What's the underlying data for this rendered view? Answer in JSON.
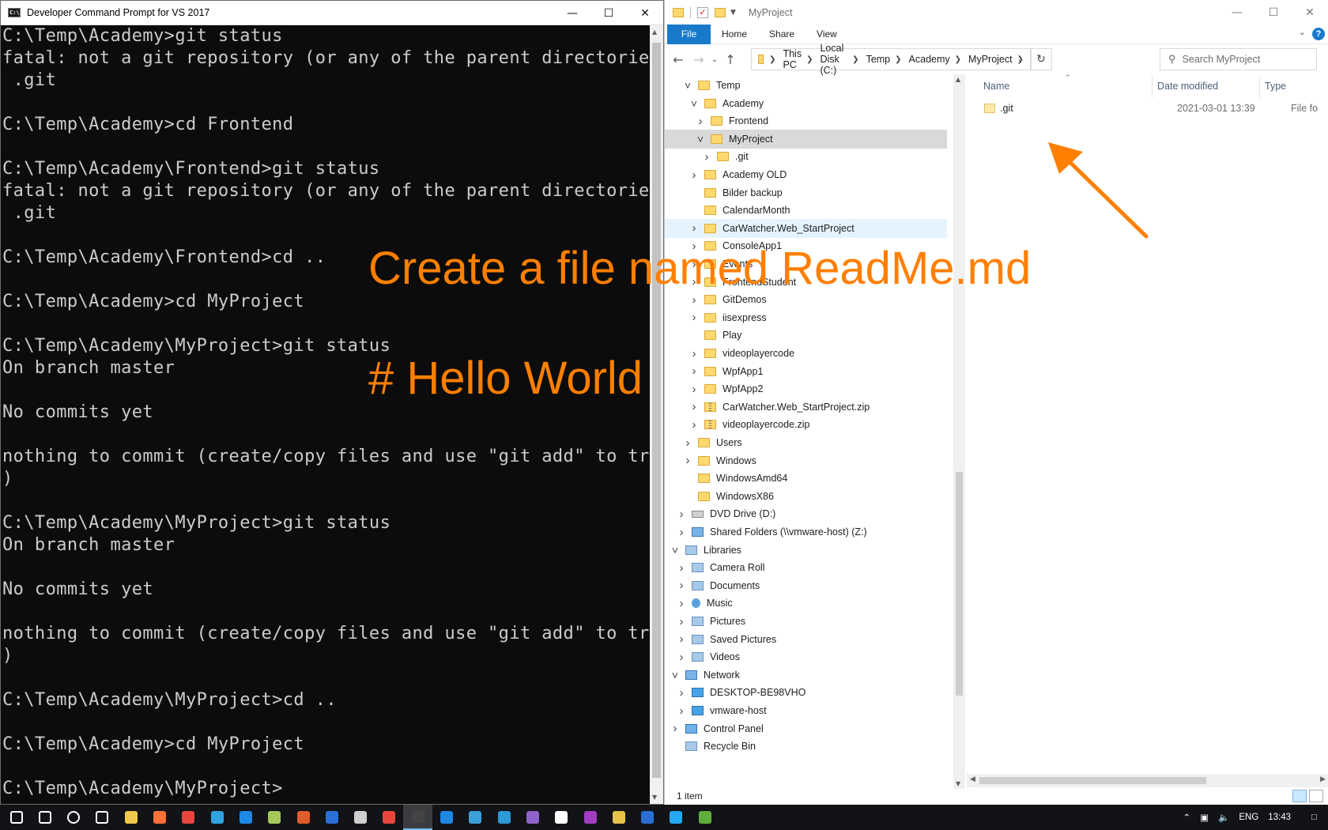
{
  "cmd": {
    "title": "Developer Command Prompt for VS 2017",
    "lines": [
      "C:\\Temp\\Academy>git status",
      "fatal: not a git repository (or any of the parent directories):",
      " .git",
      "",
      "C:\\Temp\\Academy>cd Frontend",
      "",
      "C:\\Temp\\Academy\\Frontend>git status",
      "fatal: not a git repository (or any of the parent directories):",
      " .git",
      "",
      "C:\\Temp\\Academy\\Frontend>cd ..",
      "",
      "C:\\Temp\\Academy>cd MyProject",
      "",
      "C:\\Temp\\Academy\\MyProject>git status",
      "On branch master",
      "",
      "No commits yet",
      "",
      "nothing to commit (create/copy files and use \"git add\" to track",
      ")",
      "",
      "C:\\Temp\\Academy\\MyProject>git status",
      "On branch master",
      "",
      "No commits yet",
      "",
      "nothing to commit (create/copy files and use \"git add\" to track",
      ")",
      "",
      "C:\\Temp\\Academy\\MyProject>cd ..",
      "",
      "C:\\Temp\\Academy>cd MyProject",
      "",
      "C:\\Temp\\Academy\\MyProject>"
    ]
  },
  "explorer": {
    "title": "MyProject",
    "ribbon_tabs": [
      "File",
      "Home",
      "Share",
      "View"
    ],
    "help": "?",
    "breadcrumbs": [
      "This PC",
      "Local Disk (C:)",
      "Temp",
      "Academy",
      "MyProject"
    ],
    "search_placeholder": "Search MyProject",
    "tree": [
      {
        "label": "Temp",
        "indent": 2,
        "arrow": "open",
        "icon": "folder"
      },
      {
        "label": "Academy",
        "indent": 3,
        "arrow": "open",
        "icon": "folder"
      },
      {
        "label": "Frontend",
        "indent": 4,
        "arrow": "closed",
        "icon": "folder"
      },
      {
        "label": "MyProject",
        "indent": 4,
        "arrow": "open",
        "icon": "folder",
        "selected": true
      },
      {
        "label": ".git",
        "indent": 5,
        "arrow": "closed",
        "icon": "folder"
      },
      {
        "label": "Academy OLD",
        "indent": 3,
        "arrow": "closed",
        "icon": "folder"
      },
      {
        "label": "Bilder backup",
        "indent": 3,
        "arrow": "none",
        "icon": "folder"
      },
      {
        "label": "CalendarMonth",
        "indent": 3,
        "arrow": "none",
        "icon": "folder"
      },
      {
        "label": "CarWatcher.Web_StartProject",
        "indent": 3,
        "arrow": "closed",
        "icon": "folder",
        "hover": true
      },
      {
        "label": "ConsoleApp1",
        "indent": 3,
        "arrow": "closed",
        "icon": "folder"
      },
      {
        "label": "Events",
        "indent": 3,
        "arrow": "closed",
        "icon": "folder"
      },
      {
        "label": "FrontendStudent",
        "indent": 3,
        "arrow": "closed",
        "icon": "folder"
      },
      {
        "label": "GitDemos",
        "indent": 3,
        "arrow": "closed",
        "icon": "folder"
      },
      {
        "label": "iisexpress",
        "indent": 3,
        "arrow": "closed",
        "icon": "folder"
      },
      {
        "label": "Play",
        "indent": 3,
        "arrow": "none",
        "icon": "folder"
      },
      {
        "label": "videoplayercode",
        "indent": 3,
        "arrow": "closed",
        "icon": "folder"
      },
      {
        "label": "WpfApp1",
        "indent": 3,
        "arrow": "closed",
        "icon": "folder"
      },
      {
        "label": "WpfApp2",
        "indent": 3,
        "arrow": "closed",
        "icon": "folder"
      },
      {
        "label": "CarWatcher.Web_StartProject.zip",
        "indent": 3,
        "arrow": "closed",
        "icon": "zip"
      },
      {
        "label": "videoplayercode.zip",
        "indent": 3,
        "arrow": "closed",
        "icon": "zip"
      },
      {
        "label": "Users",
        "indent": 2,
        "arrow": "closed",
        "icon": "folder"
      },
      {
        "label": "Windows",
        "indent": 2,
        "arrow": "closed",
        "icon": "folder"
      },
      {
        "label": "WindowsAmd64",
        "indent": 2,
        "arrow": "none",
        "icon": "folder"
      },
      {
        "label": "WindowsX86",
        "indent": 2,
        "arrow": "none",
        "icon": "folder"
      },
      {
        "label": "DVD Drive (D:)",
        "indent": 1,
        "arrow": "closed",
        "icon": "drive"
      },
      {
        "label": "Shared Folders (\\\\vmware-host) (Z:)",
        "indent": 1,
        "arrow": "closed",
        "icon": "net"
      },
      {
        "label": "Libraries",
        "indent": 0,
        "arrow": "open",
        "icon": "lib"
      },
      {
        "label": "Camera Roll",
        "indent": 1,
        "arrow": "closed",
        "icon": "lib"
      },
      {
        "label": "Documents",
        "indent": 1,
        "arrow": "closed",
        "icon": "lib"
      },
      {
        "label": "Music",
        "indent": 1,
        "arrow": "closed",
        "icon": "music"
      },
      {
        "label": "Pictures",
        "indent": 1,
        "arrow": "closed",
        "icon": "lib"
      },
      {
        "label": "Saved Pictures",
        "indent": 1,
        "arrow": "closed",
        "icon": "lib"
      },
      {
        "label": "Videos",
        "indent": 1,
        "arrow": "closed",
        "icon": "lib"
      },
      {
        "label": "Network",
        "indent": 0,
        "arrow": "open",
        "icon": "net"
      },
      {
        "label": "DESKTOP-BE98VHO",
        "indent": 1,
        "arrow": "closed",
        "icon": "pc"
      },
      {
        "label": "vmware-host",
        "indent": 1,
        "arrow": "closed",
        "icon": "pc"
      },
      {
        "label": "Control Panel",
        "indent": 0,
        "arrow": "closed",
        "icon": "cp"
      },
      {
        "label": "Recycle Bin",
        "indent": 0,
        "arrow": "none",
        "icon": "lib"
      }
    ],
    "columns": {
      "name": "Name",
      "date": "Date modified",
      "type": "Type"
    },
    "files": [
      {
        "name": ".git",
        "date": "2021-03-01 13:39",
        "type": "File fo"
      }
    ],
    "status": "1 item"
  },
  "annotations": {
    "instruction": "Create a file named ReadMe.md",
    "content": "# Hello World",
    "color": "#ff7f00"
  },
  "taskbar": {
    "apps": [
      "start",
      "search",
      "cortana",
      "task-view",
      "file-explorer",
      "firefox",
      "chrome",
      "edge",
      "maps",
      "notepad",
      "lambda",
      "book",
      "calculator",
      "browser",
      "cmd",
      "windows-store",
      "paint",
      "pen",
      "visual-studio",
      "notes",
      "onenote",
      "archive",
      "network",
      "vscode",
      "git"
    ],
    "language": "ENG",
    "time": "13:43"
  }
}
